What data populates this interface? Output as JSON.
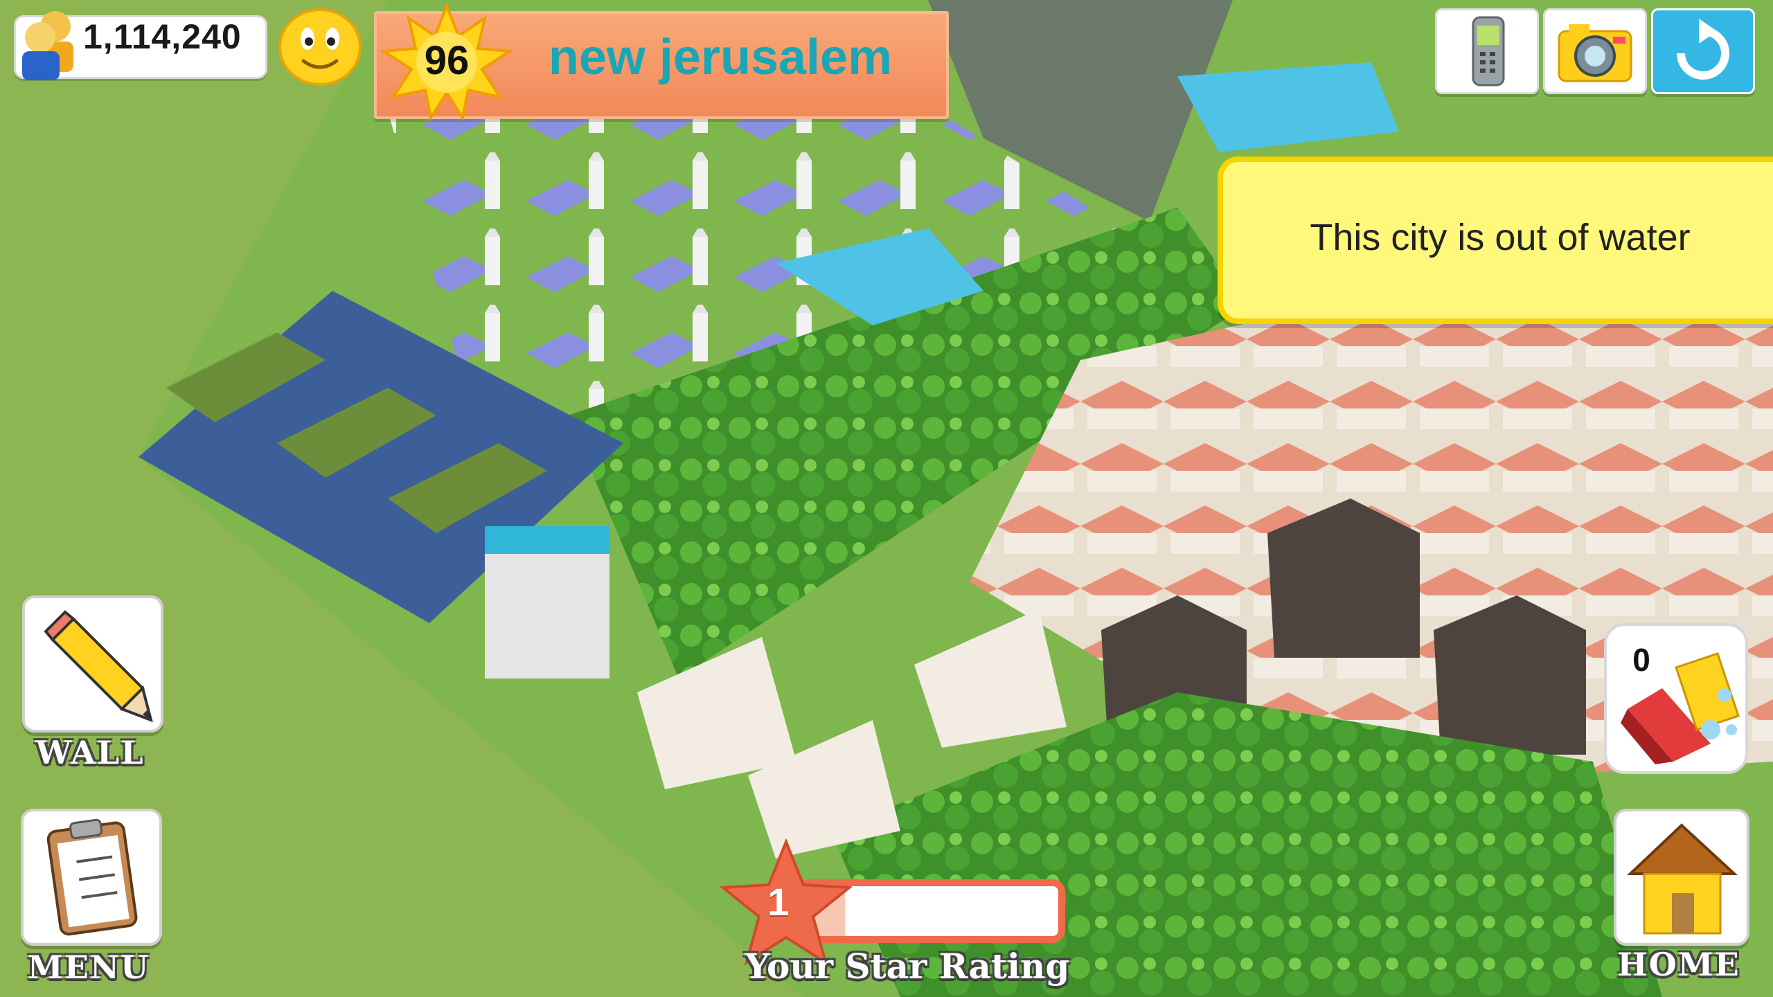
{
  "hud": {
    "population": "1,114,240",
    "population_icon": "people-icon",
    "mood_icon": "smiley-face-icon",
    "level": "96",
    "level_icon": "sun-badge-icon",
    "city_name": "new jerusalem"
  },
  "top_buttons": [
    {
      "name": "phone-button",
      "icon": "phone-icon"
    },
    {
      "name": "camera-button",
      "icon": "camera-icon"
    },
    {
      "name": "refresh-button",
      "icon": "refresh-icon"
    }
  ],
  "notice": {
    "text": "This city is out of water"
  },
  "side_buttons": {
    "wall_label": "WALL",
    "wall_icon": "pencil-icon",
    "menu_label": "MENU",
    "menu_icon": "clipboard-icon",
    "home_label": "HOME",
    "home_icon": "house-icon"
  },
  "clean_tool": {
    "count": "0",
    "icon": "sponge-icon"
  },
  "star_rating": {
    "value": "1",
    "label": "Your Star Rating",
    "progress": 0.05
  },
  "colors": {
    "grass": "#8db552",
    "banner": "#f3895a",
    "city_name": "#1aa6b5",
    "notice_bg": "#fff87a",
    "notice_border": "#f5d400",
    "rating_accent": "#ef6a4a"
  }
}
